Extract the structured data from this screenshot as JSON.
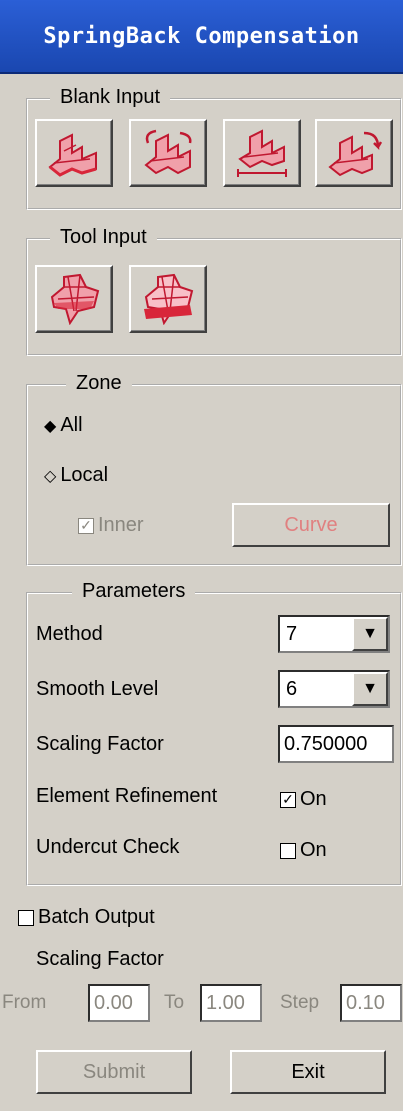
{
  "window": {
    "title": "SpringBack Compensation"
  },
  "blank_input": {
    "title": "Blank Input",
    "buttons": [
      "blank-select-icon",
      "blank-rotate-icon",
      "blank-measure-icon",
      "blank-transform-icon"
    ]
  },
  "tool_input": {
    "title": "Tool Input",
    "buttons": [
      "tool-select-icon",
      "tool-section-icon"
    ]
  },
  "zone": {
    "title": "Zone",
    "all_label": "All",
    "local_label": "Local",
    "inner_label": "Inner",
    "curve_label": "Curve",
    "selected": "All"
  },
  "parameters": {
    "title": "Parameters",
    "method_label": "Method",
    "method_value": "7",
    "smooth_label": "Smooth Level",
    "smooth_value": "6",
    "scaling_label": "Scaling Factor",
    "scaling_value": "0.750000",
    "refinement_label": "Element Refinement",
    "refinement_on_label": "On",
    "refinement_checked": true,
    "undercut_label": "Undercut Check",
    "undercut_on_label": "On",
    "undercut_checked": false
  },
  "batch": {
    "label": "Batch Output",
    "checked": false,
    "scaling_label": "Scaling Factor",
    "from_label": "From",
    "from_value": "0.00",
    "to_label": "To",
    "to_value": "1.00",
    "step_label": "Step",
    "step_value": "0.10"
  },
  "actions": {
    "submit_label": "Submit",
    "exit_label": "Exit"
  },
  "colors": {
    "title_bg": "#2b5fd6",
    "panel_bg": "#d4d0c8",
    "icon_red": "#d8263a",
    "disabled_text": "#8a877f",
    "curve_text": "#e08080"
  }
}
